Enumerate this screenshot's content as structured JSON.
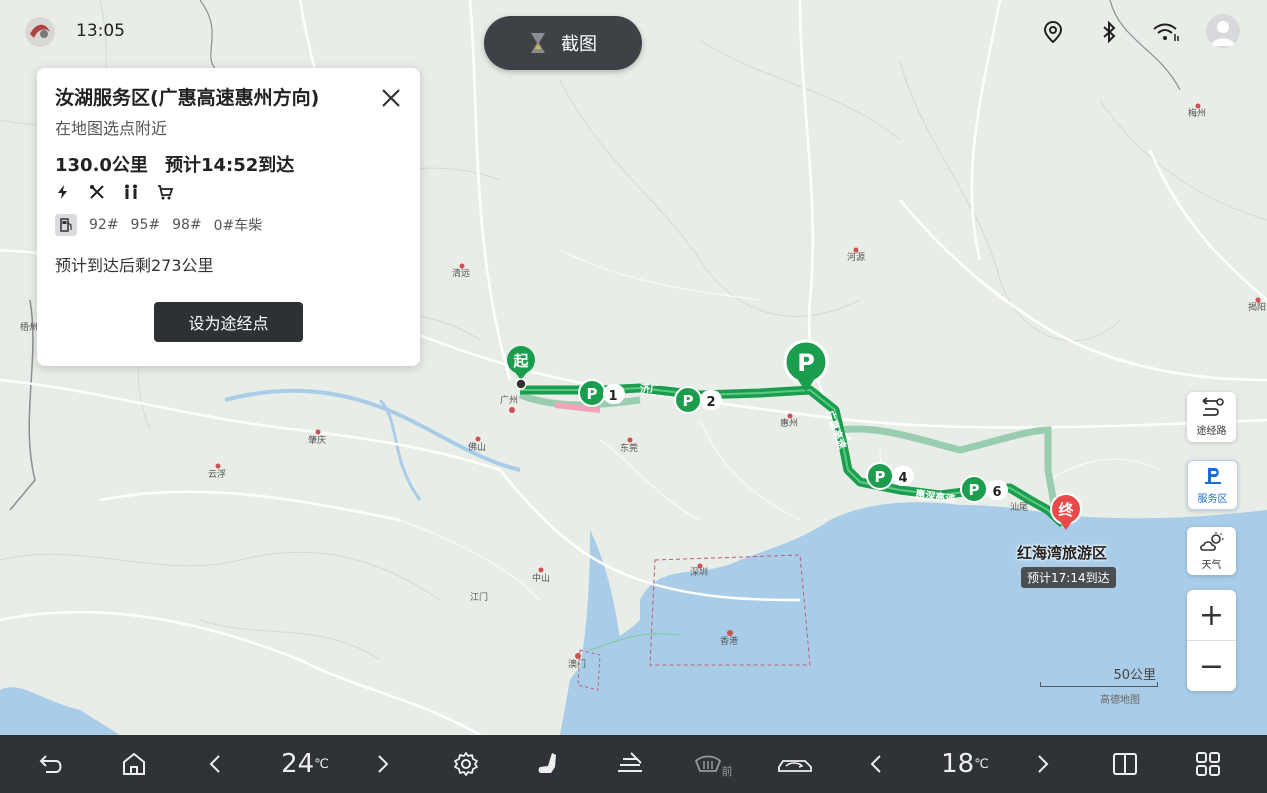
{
  "status": {
    "time": "13:05",
    "screenshot_label": "截图"
  },
  "poi_card": {
    "title": "汝湖服务区(广惠高速惠州方向)",
    "subtitle": "在地图选点附近",
    "distance": "130.0公里",
    "eta": "预计14:52到达",
    "facilities": [
      "charging-icon",
      "repair-icon",
      "restroom-icon",
      "shop-icon"
    ],
    "fuel_types": [
      "92#",
      "95#",
      "98#",
      "0#车柴"
    ],
    "remaining": "预计到达后剩273公里",
    "set_waypoint_label": "设为途经点"
  },
  "map": {
    "start_label": "起",
    "end_label": "终",
    "destination_name": "红海湾旅游区",
    "destination_eta": "预计17:14到达",
    "road_labels": [
      "济广",
      "广惠高速",
      "惠深高速"
    ],
    "service_area_numbers": [
      "1",
      "2",
      "4",
      "6"
    ],
    "cities": [
      "清远",
      "广州",
      "佛山",
      "东莞",
      "肇庆",
      "云浮",
      "中山",
      "深圳",
      "香港",
      "澳门",
      "惠州",
      "河源",
      "梅州",
      "揭阳",
      "汕尾",
      "江门",
      "梧州"
    ],
    "scale_label": "50公里",
    "provider": "高德地图"
  },
  "side_controls": {
    "waypoint_label": "途经路",
    "service_label": "服务区",
    "weather_label": "天气",
    "zoom_in": "+",
    "zoom_out": "−"
  },
  "dock": {
    "left_temp": "24",
    "right_temp": "18",
    "temp_unit": "℃",
    "front_defrost_label": "前"
  },
  "colors": {
    "route_green": "#1a9e4e",
    "alt_route": "#8fc9a8",
    "sea": "#a9cde9",
    "dock_bg": "#2f3236",
    "end_marker": "#e84a4a"
  }
}
